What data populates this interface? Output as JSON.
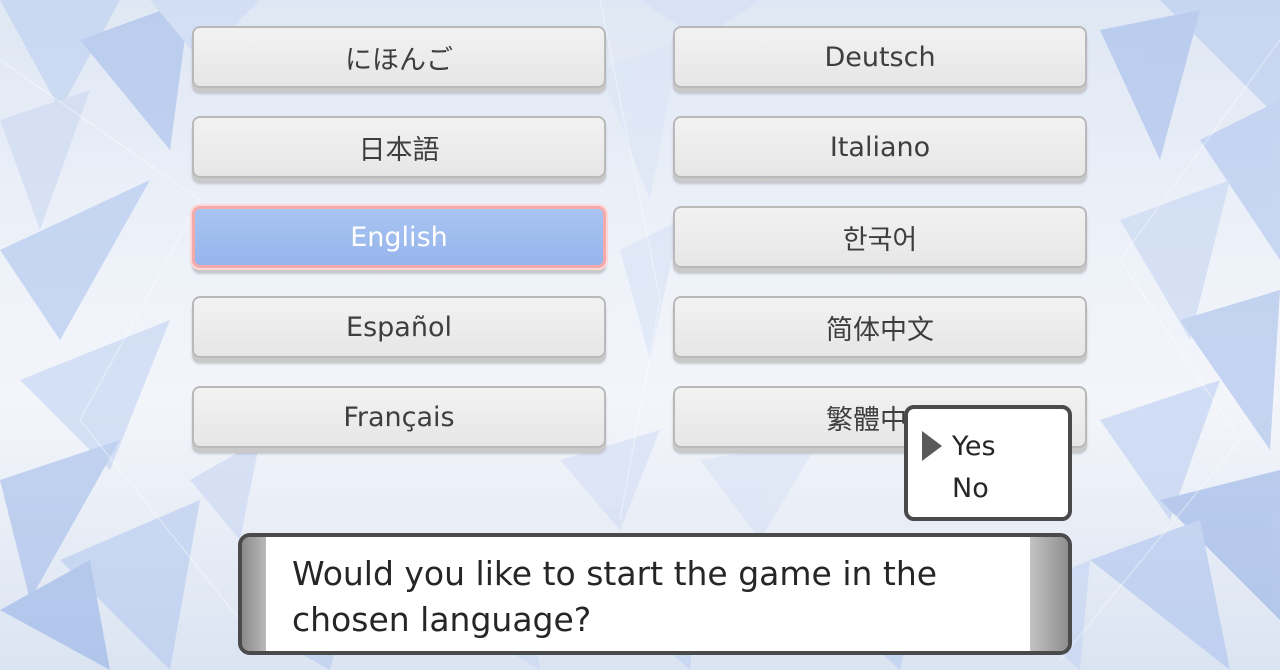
{
  "languages": {
    "left": [
      {
        "label": "にほんご"
      },
      {
        "label": "日本語"
      },
      {
        "label": "English"
      },
      {
        "label": "Español"
      },
      {
        "label": "Français"
      }
    ],
    "right": [
      {
        "label": "Deutsch"
      },
      {
        "label": "Italiano"
      },
      {
        "label": "한국어"
      },
      {
        "label": "简体中文"
      },
      {
        "label": "繁體中文"
      }
    ],
    "selected": "English"
  },
  "dialog": {
    "line1": "Would you like to start the game in the",
    "line2": "chosen language?"
  },
  "choice": {
    "yes_label": "Yes",
    "no_label": "No",
    "cursor_on": "Yes"
  },
  "colors": {
    "selected_fill": "#9fbdf0",
    "selected_border": "#f3aaaa",
    "button_fill": "#ececec",
    "text": "#3e3e3e"
  },
  "icons": {
    "cursor": "triangle-right-icon"
  }
}
